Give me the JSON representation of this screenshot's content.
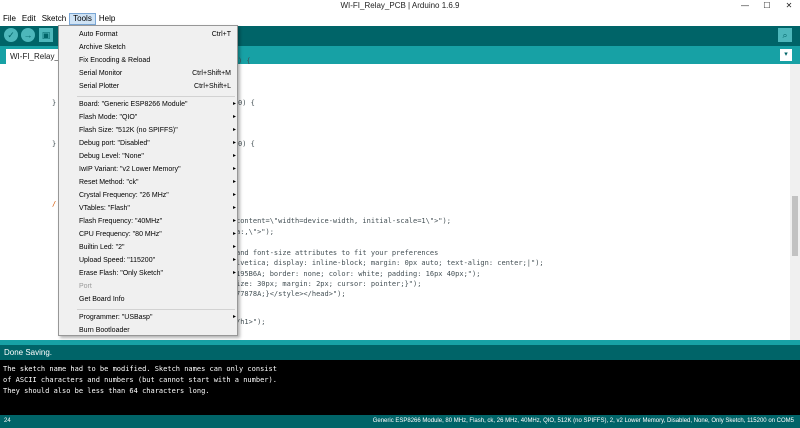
{
  "window": {
    "title": "WI-FI_Relay_PCB | Arduino 1.6.9",
    "minimize": "—",
    "maximize": "☐",
    "close": "✕"
  },
  "menubar": [
    "File",
    "Edit",
    "Sketch",
    "Tools",
    "Help"
  ],
  "toolbar": {
    "verify": "✓",
    "upload": "→",
    "new": "▣",
    "open": "↑",
    "save": "↓",
    "serial": "⌕"
  },
  "tab": {
    "label": "WI-FI_Relay_PCB",
    "menu": "▾"
  },
  "code": {
    "l1": ") {",
    "l2": "}",
    "l3": "0) {",
    "l4": "}",
    "l5": "0) {",
    "l6": "/",
    "l7": "content=\\\"width=device-width, initial-scale=1\\\">\");",
    "l8": "a:,\\\">\");",
    "l9": "and font-size attributes to fit your preferences",
    "l10": "lvetica; display: inline-block; margin: 0px auto; text-align: center;|\");",
    "l11": "195B6A; border: none; color: white; padding: 16px 40px;\");",
    "l12": "ize: 30px; margin: 2px; cursor: pointer;}\");",
    "l13": "77878A;}</style></head>\");",
    "l14": "/h1>\");"
  },
  "status": "Done Saving.",
  "console": [
    "The sketch name had to be modified. Sketch names can only consist",
    "of ASCII characters and numbers (but cannot start with a number).",
    "They should also be less than 64 characters long."
  ],
  "bottom": {
    "line": "24",
    "board": "Generic ESP8266 Module, 80 MHz, Flash, ck, 26 MHz, 40MHz, QIO, 512K (no SPIFFS), 2, v2 Lower Memory, Disabled, None, Only Sketch, 115200 on COM5"
  },
  "tools_menu": {
    "auto_format": "Auto Format",
    "auto_format_sc": "Ctrl+T",
    "archive": "Archive Sketch",
    "fix_encoding": "Fix Encoding & Reload",
    "serial_monitor": "Serial Monitor",
    "serial_monitor_sc": "Ctrl+Shift+M",
    "serial_plotter": "Serial Plotter",
    "serial_plotter_sc": "Ctrl+Shift+L",
    "board": "Board: \"Generic ESP8266 Module\"",
    "flash_mode": "Flash Mode: \"QIO\"",
    "flash_size": "Flash Size: \"512K (no SPIFFS)\"",
    "debug_port": "Debug port: \"Disabled\"",
    "debug_level": "Debug Level: \"None\"",
    "lwip": "IwIP Variant: \"v2 Lower Memory\"",
    "reset": "Reset Method: \"ck\"",
    "crystal": "Crystal Frequency: \"26 MHz\"",
    "vtables": "VTables: \"Flash\"",
    "flash_freq": "Flash Frequency: \"40MHz\"",
    "cpu_freq": "CPU Frequency: \"80 MHz\"",
    "builtin_led": "Builtin Led: \"2\"",
    "upload_speed": "Upload Speed: \"115200\"",
    "erase_flash": "Erase Flash: \"Only Sketch\"",
    "port": "Port",
    "board_info": "Get Board Info",
    "programmer": "Programmer: \"USBasp\"",
    "burn": "Burn Bootloader",
    "arrow": "▸"
  }
}
